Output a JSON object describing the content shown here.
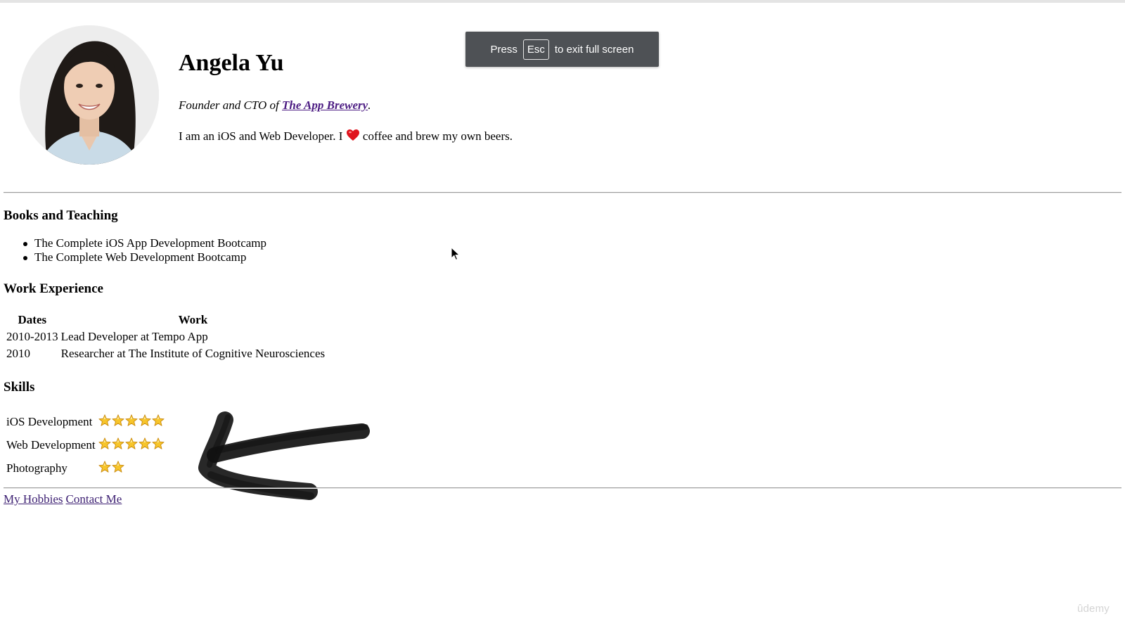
{
  "profile": {
    "name": "Angela Yu",
    "tagline_prefix": "Founder and CTO of ",
    "company_link": "The App Brewery",
    "tagline_suffix": ".",
    "bio_before": "I am an iOS and Web Developer. I ",
    "bio_after": " coffee and brew my own beers."
  },
  "books": {
    "heading": "Books and Teaching",
    "items": [
      "The Complete iOS App Development Bootcamp",
      "The Complete Web Development Bootcamp"
    ]
  },
  "work": {
    "heading": "Work Experience",
    "columns": [
      "Dates",
      "Work"
    ],
    "rows": [
      {
        "dates": "2010-2013",
        "work": "Lead Developer at Tempo App"
      },
      {
        "dates": "2010",
        "work": "Researcher at The Institute of Cognitive Neurosciences"
      }
    ]
  },
  "skills": {
    "heading": "Skills",
    "rows": [
      {
        "name": "iOS Development",
        "stars": 5
      },
      {
        "name": "Web Development",
        "stars": 5
      },
      {
        "name": "Photography",
        "stars": 2
      }
    ]
  },
  "footer": {
    "links": [
      "My Hobbies",
      "Contact Me"
    ]
  },
  "fullscreen_notice": {
    "press": "Press",
    "key": "Esc",
    "rest": "to exit full screen"
  },
  "watermark": "ûdemy",
  "icons": {
    "heart": "heart-icon",
    "star": "star-icon",
    "cursor": "mouse-cursor-icon"
  },
  "colors": {
    "link_visited": "#4b1b82",
    "heart": "#e0141e",
    "star_fill": "#f7c52a",
    "toast_bg": "#4e5155"
  }
}
